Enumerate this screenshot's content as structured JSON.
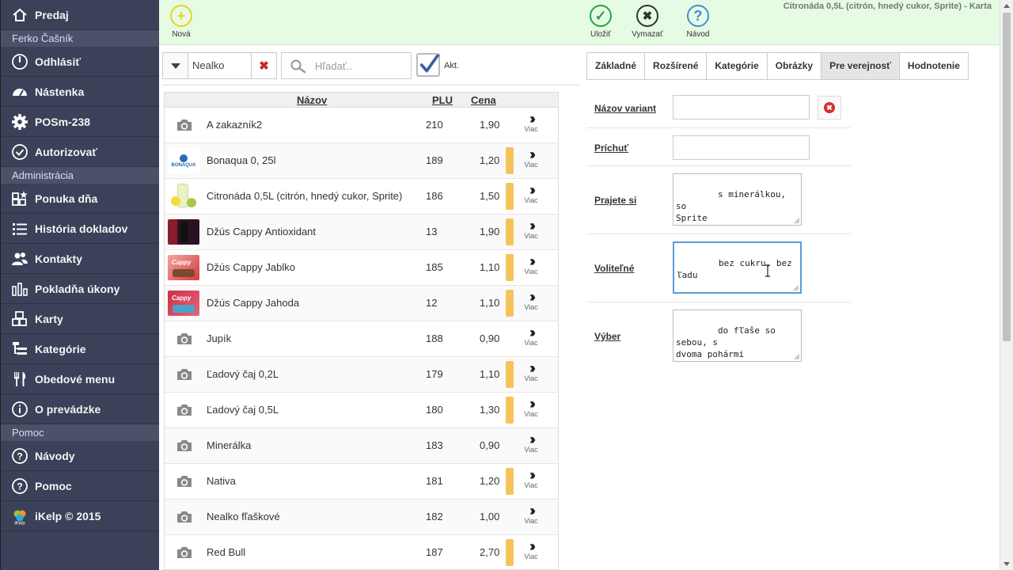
{
  "sidebar": {
    "items": [
      {
        "label": "Predaj",
        "icon": "home-icon"
      },
      {
        "section": "Ferko Čašník"
      },
      {
        "label": "Odhlásiť",
        "icon": "power-icon"
      },
      {
        "label": "Nástenka",
        "icon": "dashboard-icon"
      },
      {
        "label": "POSm-238",
        "icon": "gear-icon"
      },
      {
        "label": "Autorizovať",
        "icon": "check-circle-icon"
      },
      {
        "section": "Administrácia"
      },
      {
        "label": "Ponuka dňa",
        "icon": "blocks-star-icon"
      },
      {
        "label": "História dokladov",
        "icon": "list-icon"
      },
      {
        "label": "Kontakty",
        "icon": "users-icon"
      },
      {
        "label": "Pokladňa úkony",
        "icon": "bar-chart-icon"
      },
      {
        "label": "Karty",
        "icon": "cubes-icon"
      },
      {
        "label": "Kategórie",
        "icon": "tree-icon"
      },
      {
        "label": "Obedové menu",
        "icon": "cutlery-icon"
      },
      {
        "label": "O prevádzke",
        "icon": "info-icon"
      },
      {
        "section": "Pomoc"
      },
      {
        "label": "Návody",
        "icon": "question-icon"
      },
      {
        "label": "Pomoc",
        "icon": "question-icon"
      },
      {
        "label": "iKelp © 2015",
        "icon": "ikelp-logo"
      }
    ]
  },
  "toolbar": {
    "new_label": "Nová",
    "save_label": "Uložiť",
    "delete_label": "Vymazať",
    "help_label": "Návod",
    "window_title": "Citronáda 0,5L (citrón, hnedý cukor, Sprite) - Karta"
  },
  "filter": {
    "category_value": "Nealko",
    "search_placeholder": "Hľadať..",
    "active_label": "Akt.",
    "active_checked": true
  },
  "table": {
    "headers": {
      "name": "Názov",
      "plu": "PLU",
      "price": "Cena"
    },
    "more_label": "Viac",
    "rows": [
      {
        "name": "A zakazník2",
        "plu": "210",
        "price": "1,90",
        "thumb": "camera",
        "bar": false
      },
      {
        "name": "Bonaqua 0, 25l",
        "plu": "189",
        "price": "1,20",
        "thumb": "bonaqua",
        "bar": true
      },
      {
        "name": "Citronáda 0,5L (citrón, hnedý cukor, Sprite)",
        "plu": "186",
        "price": "1,50",
        "thumb": "lemon",
        "bar": true
      },
      {
        "name": "Džús Cappy Antioxidant",
        "plu": "13",
        "price": "1,90",
        "thumb": "cappy-dark",
        "bar": true
      },
      {
        "name": "Džús Cappy Jablko",
        "plu": "185",
        "price": "1,10",
        "thumb": "cappy-apple",
        "bar": true
      },
      {
        "name": "Džús Cappy Jahoda",
        "plu": "12",
        "price": "1,10",
        "thumb": "cappy-red",
        "bar": true
      },
      {
        "name": "Jupík",
        "plu": "188",
        "price": "0,90",
        "thumb": "camera",
        "bar": false
      },
      {
        "name": "Ľadový čaj 0,2L",
        "plu": "179",
        "price": "1,10",
        "thumb": "camera",
        "bar": true
      },
      {
        "name": "Ľadový čaj 0,5L",
        "plu": "180",
        "price": "1,30",
        "thumb": "camera",
        "bar": true
      },
      {
        "name": "Minerálka",
        "plu": "183",
        "price": "0,90",
        "thumb": "camera",
        "bar": false
      },
      {
        "name": "Nativa",
        "plu": "181",
        "price": "1,20",
        "thumb": "camera",
        "bar": true
      },
      {
        "name": "Nealko fľaškové",
        "plu": "182",
        "price": "1,00",
        "thumb": "camera",
        "bar": false
      },
      {
        "name": "Red Bull",
        "plu": "187",
        "price": "2,70",
        "thumb": "camera",
        "bar": true
      }
    ]
  },
  "tabs": [
    {
      "label": "Základné",
      "active": false
    },
    {
      "label": "Rozšírené",
      "active": false
    },
    {
      "label": "Kategórie",
      "active": false
    },
    {
      "label": "Obrázky",
      "active": false
    },
    {
      "label": "Pre verejnosť",
      "active": true
    },
    {
      "label": "Hodnotenie",
      "active": false
    }
  ],
  "form": {
    "variant_name_label": "Názov variant",
    "variant_name_value": "",
    "flavor_label": "Príchuť",
    "flavor_value": "",
    "wish_label": "Prajete si",
    "wish_value": "s minerálkou, so\nSprite",
    "optional_label": "Voliteľné",
    "optional_value": "bez cukru, bez ľadu",
    "choice_label": "Výber",
    "choice_value": "do fľaše so sebou, s\ndvoma pohármi"
  },
  "colors": {
    "sidebar_bg": "#3a4158",
    "toolbar_bg": "#e6fbe4",
    "active_bar": "#f6c35b",
    "delete_red": "#d32f2f",
    "save_green": "#2e9e44",
    "help_blue": "#3f8fd6"
  }
}
